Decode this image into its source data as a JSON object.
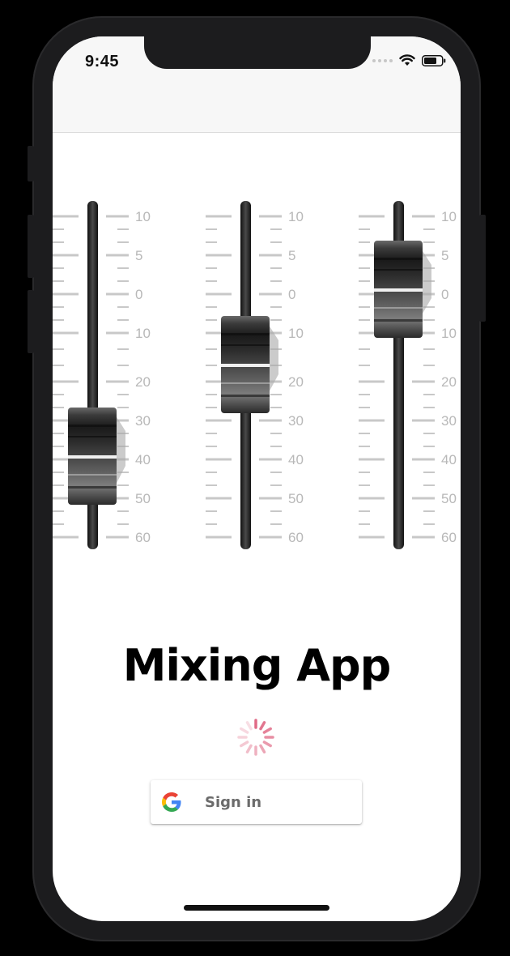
{
  "status_bar": {
    "time": "9:45"
  },
  "faders": {
    "scale_labels": [
      "10",
      "5",
      "0",
      "10",
      "20",
      "30",
      "40",
      "50",
      "60"
    ],
    "channels": [
      {
        "name": "fader-1",
        "level": "36"
      },
      {
        "name": "fader-2",
        "level": "17"
      },
      {
        "name": "fader-3",
        "level": "0"
      }
    ]
  },
  "title": "Mixing App",
  "signin": {
    "label": "Sign in",
    "icon": "google-logo-icon"
  },
  "colors": {
    "spinner": "#e06a86",
    "text": "#000000",
    "signin_text": "#6b6b6b"
  }
}
